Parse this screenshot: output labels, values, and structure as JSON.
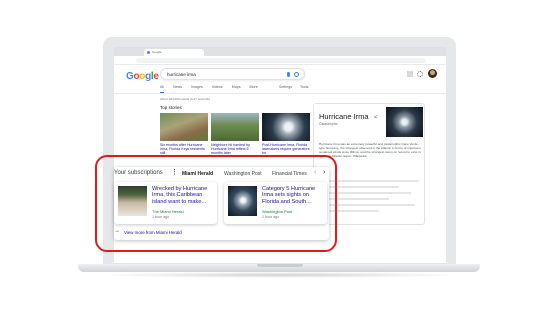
{
  "browser": {
    "tab_title": "Google"
  },
  "header": {
    "query": "hurricane irma",
    "tabs": [
      "All",
      "News",
      "Images",
      "Videos",
      "Maps",
      "More"
    ],
    "right_tabs": [
      "Settings",
      "Tools"
    ],
    "result_stats": "About 484,000 results (0.47 seconds)"
  },
  "top_stories": {
    "title": "Top stories",
    "items": [
      {
        "headline": "Six months after Hurricane Irma, Florida Keys residents still"
      },
      {
        "headline": "Neighbors hit hardest by Hurricane Irma reflect 6 months later"
      },
      {
        "headline": "Post-Hurricane Irma, Florida lawmakers require generators for"
      }
    ]
  },
  "knowledge_panel": {
    "title": "Hurricane Irma",
    "subtitle": "Catastrophe",
    "description": "Hurricane Irma was an extremely powerful and catastrophic Cape Verde-type hurricane, the strongest observed in the Atlantic in terms of maximum sustained winds since Wilma, and the strongest storm on record to exist in the open Atlantic region. Wikipedia"
  },
  "subscriptions": {
    "title": "Your subscriptions",
    "sources": [
      "Miami Herald",
      "Washington Post",
      "Financial Times"
    ],
    "cards": [
      {
        "headline": "Wrecked by Hurricane Irma, this Caribbean island want to make...",
        "source": "The Miami Herald",
        "time": "1 hour ago"
      },
      {
        "headline": "Category 5 Hurricane Irma sets sights on Florida and South...",
        "source": "Washington Post",
        "time": "1 hour ago"
      }
    ],
    "view_more": "View more from Miami Herald"
  },
  "colors": {
    "highlight": "#e01b1b",
    "link": "#1a0dab",
    "source_green": "#188038"
  }
}
